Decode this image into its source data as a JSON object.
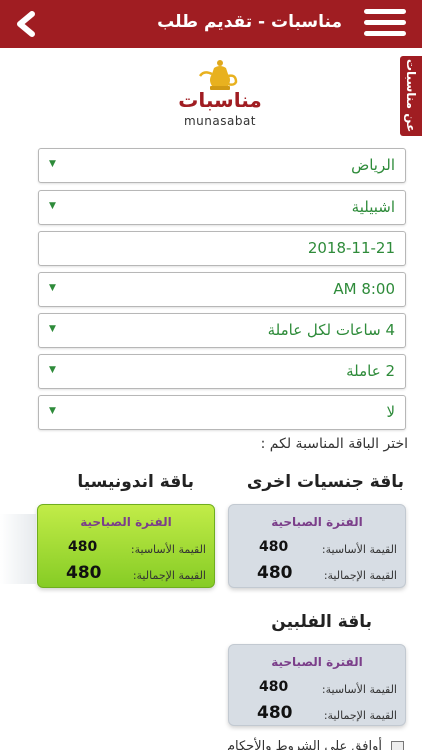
{
  "header": {
    "title": "مناسبات - تقديم طلب",
    "colors": {
      "brand": "#a01d22",
      "accent_green": "#2e8b3a"
    }
  },
  "side_tab": {
    "label": "عن مناسبات"
  },
  "logo": {
    "arabic": "مناسبات",
    "english": "munasabat"
  },
  "form": {
    "city": "الرياض",
    "district": "اشبيلية",
    "date": "2018-11-21",
    "time": "AM 8:00",
    "hours": "4 ساعات لكل عاملة",
    "workers": "2 عاملة",
    "extra": "لا"
  },
  "prompt": "اختر الباقة المناسبة لكم :",
  "packages": [
    {
      "title": "باقة جنسيات اخرى",
      "period": "الفترة الصباحية",
      "base_label": "القيمة الأساسية:",
      "base_value": "480",
      "total_label": "القيمة الإجمالية:",
      "total_value": "480",
      "selected": false
    },
    {
      "title": "باقة اندونيسيا",
      "period": "الفترة الصباحية",
      "base_label": "القيمة الأساسية:",
      "base_value": "480",
      "total_label": "القيمة الإجمالية:",
      "total_value": "480",
      "selected": true
    },
    {
      "title": "باقة الفلبين",
      "period": "الفترة الصباحية",
      "base_label": "القيمة الأساسية:",
      "base_value": "480",
      "total_label": "القيمة الإجمالية:",
      "total_value": "480",
      "selected": false
    }
  ],
  "footer": {
    "checkbox_text": "أوافق على الشروط والأحكام"
  }
}
